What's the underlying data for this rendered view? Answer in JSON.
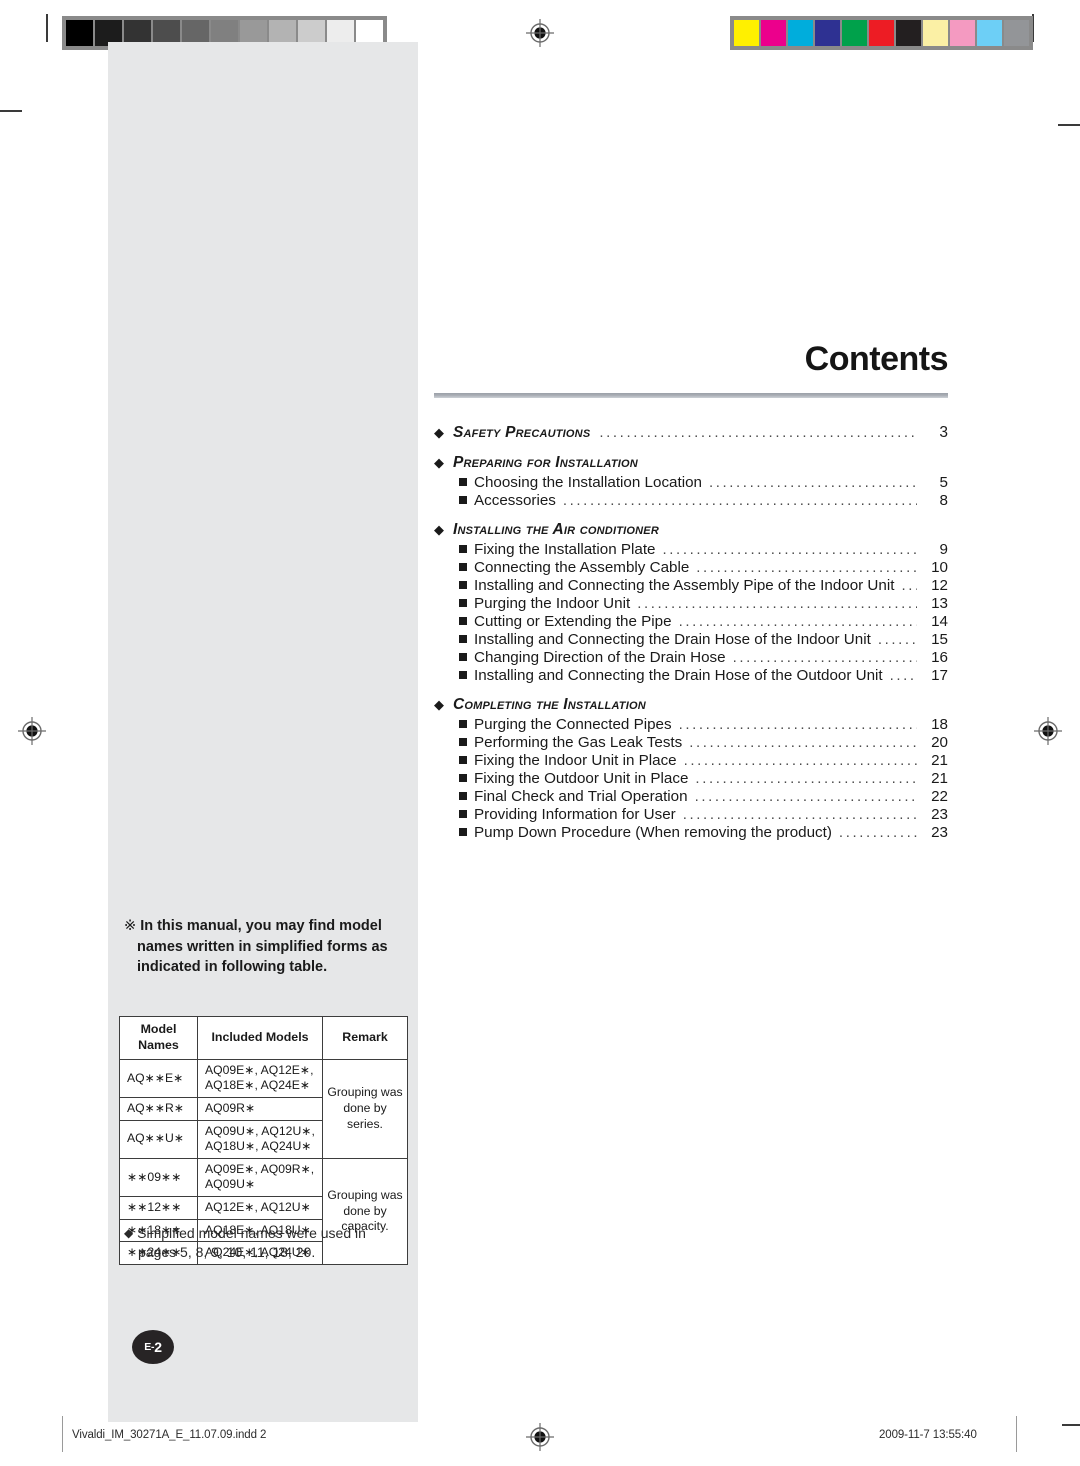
{
  "document": {
    "page_badge": "E-2",
    "page_badge_prefix": "E-",
    "page_badge_number": "2"
  },
  "prepress": {
    "grayscale_wedge_label": "grayscale-step-wedge",
    "grayscale_patches": [
      "#000000",
      "#1c1c1c",
      "#333333",
      "#4d4d4d",
      "#666666",
      "#808080",
      "#999999",
      "#b3b3b3",
      "#cccccc",
      "#ededed",
      "#ffffff"
    ],
    "color_bar_label": "color-control-bar",
    "color_patches": [
      "#fff000",
      "#ec008c",
      "#00addc",
      "#2e3192",
      "#00a14b",
      "#ed1c24",
      "#231f20",
      "#fbf0a5",
      "#f49ac1",
      "#6dcff6",
      "#939598"
    ],
    "registration_mark_label": "registration-mark"
  },
  "contents": {
    "title": "Contents",
    "sections": [
      {
        "label": "Safety Precautions",
        "page": "3",
        "has_leaders": true,
        "entries": []
      },
      {
        "label": "Preparing for Installation",
        "page": "",
        "has_leaders": false,
        "entries": [
          {
            "label": "Choosing the Installation Location",
            "page": "5"
          },
          {
            "label": "Accessories",
            "page": "8"
          }
        ]
      },
      {
        "label": "Installing the Air conditioner",
        "page": "",
        "has_leaders": false,
        "entries": [
          {
            "label": "Fixing the Installation Plate",
            "page": "9"
          },
          {
            "label": "Connecting the Assembly Cable",
            "page": "10"
          },
          {
            "label": "Installing and Connecting the Assembly Pipe of the Indoor Unit",
            "page": "12"
          },
          {
            "label": "Purging the Indoor Unit",
            "page": "13"
          },
          {
            "label": "Cutting or Extending the Pipe",
            "page": "14"
          },
          {
            "label": "Installing and Connecting the Drain Hose of the Indoor Unit",
            "page": "15"
          },
          {
            "label": "Changing Direction of the Drain Hose",
            "page": "16"
          },
          {
            "label": "Installing and Connecting the Drain Hose of the Outdoor Unit",
            "page": "17"
          }
        ]
      },
      {
        "label": "Completing the Installation",
        "page": "",
        "has_leaders": false,
        "entries": [
          {
            "label": "Purging the Connected Pipes",
            "page": "18"
          },
          {
            "label": "Performing the Gas Leak Tests",
            "page": "20"
          },
          {
            "label": "Fixing the Indoor Unit in Place",
            "page": "21"
          },
          {
            "label": "Fixing the Outdoor Unit in Place",
            "page": "21"
          },
          {
            "label": "Final Check and Trial Operation",
            "page": "22"
          },
          {
            "label": "Providing Information for User",
            "page": "23"
          },
          {
            "label": "Pump Down Procedure (When removing the product)",
            "page": "23"
          }
        ]
      }
    ]
  },
  "sidebar": {
    "note_symbol": "※",
    "note_line1": "In this manual, you may find model",
    "note_line2": "names written in simplified forms as",
    "note_line3": "indicated in following table.",
    "table": {
      "headers": [
        "Model Names",
        "Included Models",
        "Remark"
      ],
      "header_col1_line1": "Model",
      "header_col1_line2": "Names",
      "header_col2": "Included Models",
      "header_col3": "Remark",
      "rows": [
        {
          "name": "AQ∗∗E∗",
          "models": "AQ09E∗, AQ12E∗,\nAQ18E∗, AQ24E∗"
        },
        {
          "name": "AQ∗∗R∗",
          "models": "AQ09R∗"
        },
        {
          "name": "AQ∗∗U∗",
          "models": "AQ09U∗, AQ12U∗,\nAQ18U∗, AQ24U∗"
        },
        {
          "name": "∗∗09∗∗",
          "models": "AQ09E∗, AQ09R∗,\nAQ09U∗"
        },
        {
          "name": "∗∗12∗∗",
          "models": "AQ12E∗, AQ12U∗"
        },
        {
          "name": "∗∗18∗∗",
          "models": "AQ18E∗, AQ18U∗"
        },
        {
          "name": "∗∗24∗∗",
          "models": "AQ24E∗, AQ24U∗"
        }
      ],
      "remark_series": "Grouping was done by series.",
      "remark_capacity": "Grouping was done by capacity."
    },
    "footnote_bullet": "◆",
    "footnote_line1": "Simplfied model names were used in",
    "footnote_line2": "pages 5, 8, 9, 10, 11, 18, 20."
  },
  "footer": {
    "filename": "Vivaldi_IM_30271A_E_11.07.09.indd   2",
    "timestamp": "2009-11-7   13:55:40"
  },
  "glyphs": {
    "diamond": "◆",
    "leader_dots": "...........................................................................................................................",
    "square_bullet": "■"
  }
}
